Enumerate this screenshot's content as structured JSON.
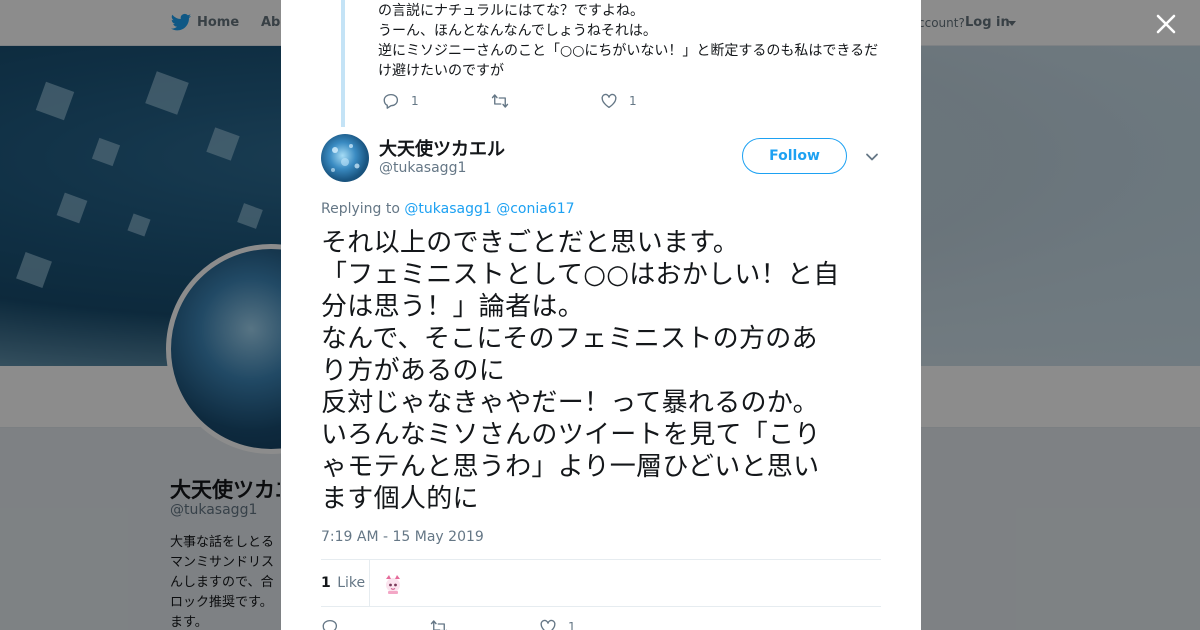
{
  "topbar": {
    "home_label": "Home",
    "about_label": "Abo",
    "account_text": "ccount?",
    "login_label": "Log in"
  },
  "profile": {
    "name": "大天使ツカエ",
    "handle": "@tukasagg1",
    "bio_lines": [
      "大事な話をしとる",
      "マンミサンドリス",
      "んしますので、合",
      "ロック推奨です。",
      "ます。"
    ]
  },
  "parent_tweet": {
    "lines": [
      "の言説にナチュラルにはてな？ですよね。",
      "うーん、ほんとなんなんでしょうねそれは。",
      "逆にミソジニーさんのこと「○○にちがいない！」と断定するのも私はできるだ",
      "け避けたいのですが"
    ],
    "reply_count": "1",
    "retweet_count": "",
    "like_count": "1"
  },
  "main_tweet": {
    "name": "大天使ツカエル",
    "handle": "@tukasagg1",
    "follow_label": "Follow",
    "replying_prefix": "Replying to",
    "replying_to": [
      "@tukasagg1",
      "@conia617"
    ],
    "body_lines": [
      "それ以上のできごとだと思います。",
      "「フェミニストとして○○はおかしい！と自",
      "分は思う！」論者は。",
      "なんで、そこにそのフェミニストの方のあ",
      "り方があるのに",
      "反対じゃなきゃやだー！って暴れるのか。",
      "いろんなミソさんのツイートを見て「こり",
      "ゃモテんと思うわ」より一層ひどいと思い",
      "ます個人的に"
    ],
    "timestamp": "7:19 AM - 15 May 2019",
    "like_stat_count": "1",
    "like_stat_label": "Like",
    "reply_count": "",
    "retweet_count": "",
    "like_count": "1"
  },
  "colors": {
    "accent": "#1da1f2",
    "muted": "#657786",
    "text": "#14171a",
    "thread_line": "#c4e3f6"
  },
  "icons": {
    "close": "close-icon",
    "reply": "reply-icon",
    "retweet": "retweet-icon",
    "like": "heart-icon",
    "chevron": "chevron-down-icon",
    "brand": "bird-icon"
  }
}
